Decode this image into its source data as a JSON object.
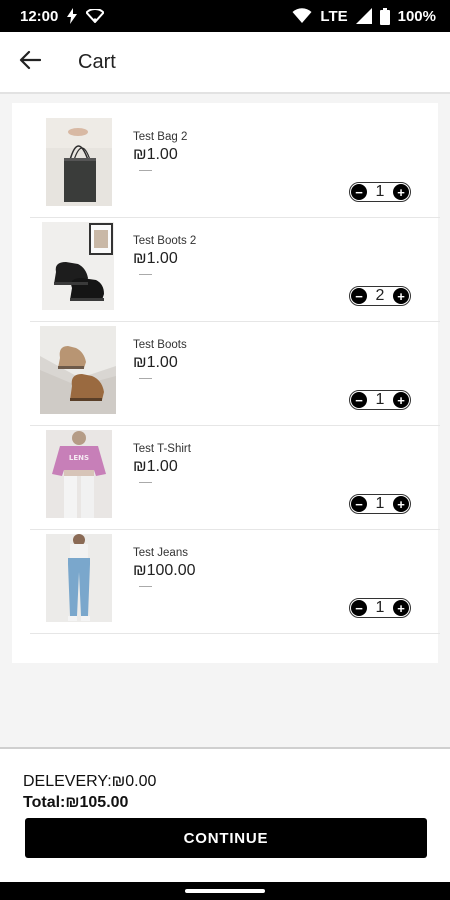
{
  "status": {
    "time": "12:00",
    "network": "LTE",
    "battery": "100%",
    "icons": [
      "flash-icon",
      "wifi-small-icon",
      "wifi-icon",
      "signal-icon",
      "battery-icon"
    ]
  },
  "header": {
    "back_icon": "arrow-left-icon",
    "title": "Cart"
  },
  "cart": {
    "items": [
      {
        "name": "Test Bag 2",
        "price": "₪1.00",
        "qty": "1",
        "image": "tote-bag-photo"
      },
      {
        "name": "Test Boots 2",
        "price": "₪1.00",
        "qty": "2",
        "image": "black-boots-photo"
      },
      {
        "name": "Test Boots",
        "price": "₪1.00",
        "qty": "1",
        "image": "brown-boots-photo"
      },
      {
        "name": "Test T-Shirt",
        "price": "₪1.00",
        "qty": "1",
        "image": "pink-sweatshirt-photo"
      },
      {
        "name": "Test Jeans",
        "price": "₪100.00",
        "qty": "1",
        "image": "blue-jeans-photo"
      }
    ],
    "minus_symbol": "−",
    "plus_symbol": "+"
  },
  "summary": {
    "delivery": "DELEVERY:₪0.00",
    "total": "Total:₪105.00",
    "continue_label": "CONTINUE"
  }
}
